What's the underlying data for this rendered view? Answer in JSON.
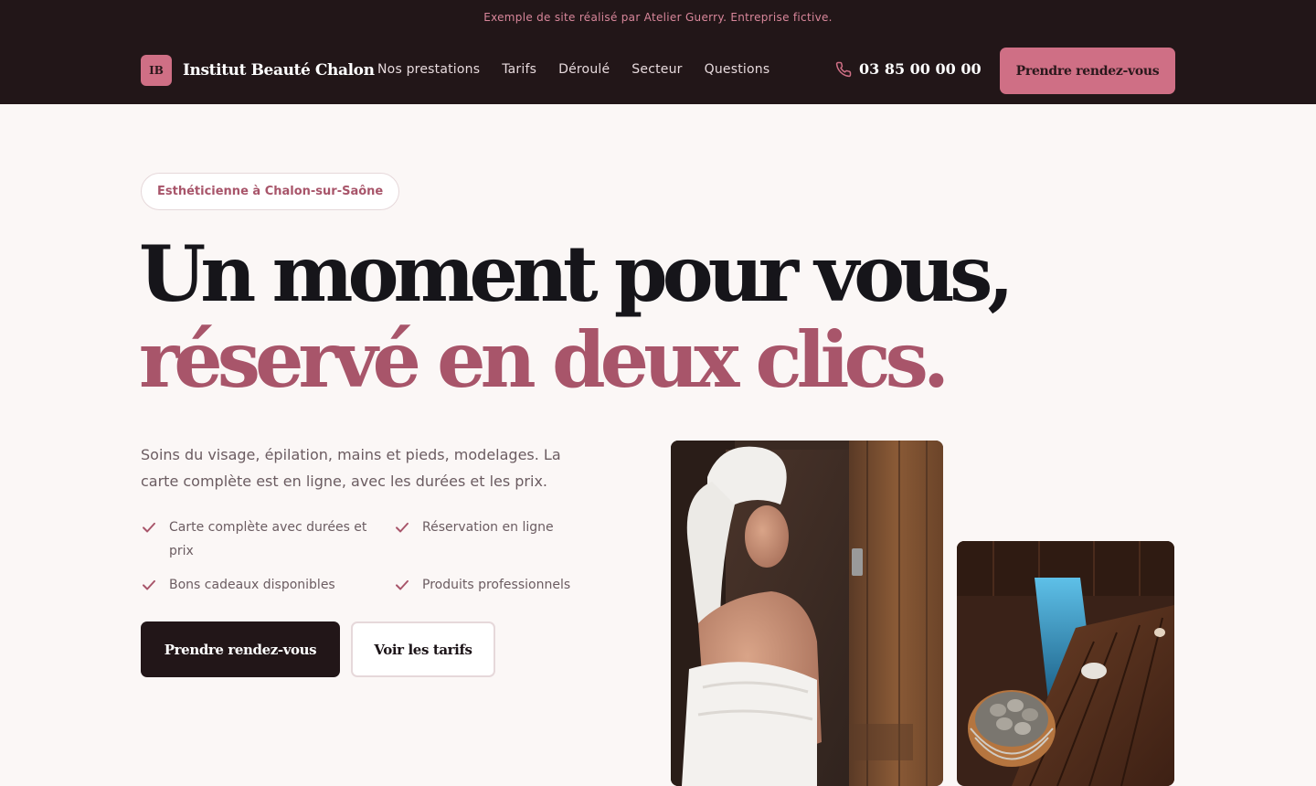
{
  "banner": {
    "notice": "Exemple de site réalisé par Atelier Guerry. Entreprise fictive."
  },
  "header": {
    "logo_initials": "IB",
    "brand_name": "Institut Beauté Chalon",
    "nav": [
      "Nos prestations",
      "Tarifs",
      "Déroulé",
      "Secteur",
      "Questions"
    ],
    "phone": "03 85 00 00 00",
    "cta_label": "Prendre rendez-vous"
  },
  "hero": {
    "pill": "Esthéticienne à Chalon-sur-Saône",
    "title_line1": "Un moment pour vous,",
    "title_line2": "réservé en deux clics.",
    "lead": "Soins du visage, épilation, mains et pieds, modelages. La carte complète est en ligne, avec les durées et les prix.",
    "features": [
      "Carte complète avec durées et prix",
      "Réservation en ligne",
      "Bons cadeaux disponibles",
      "Produits professionnels"
    ],
    "primary_button": "Prendre rendez-vous",
    "secondary_button": "Voir les tarifs"
  },
  "icons": {
    "phone": "phone-icon",
    "check": "check-icon"
  },
  "colors": {
    "dark": "#221618",
    "accent": "#cf6f85",
    "accent_text": "#a8556a",
    "background": "#fbf7f6"
  }
}
